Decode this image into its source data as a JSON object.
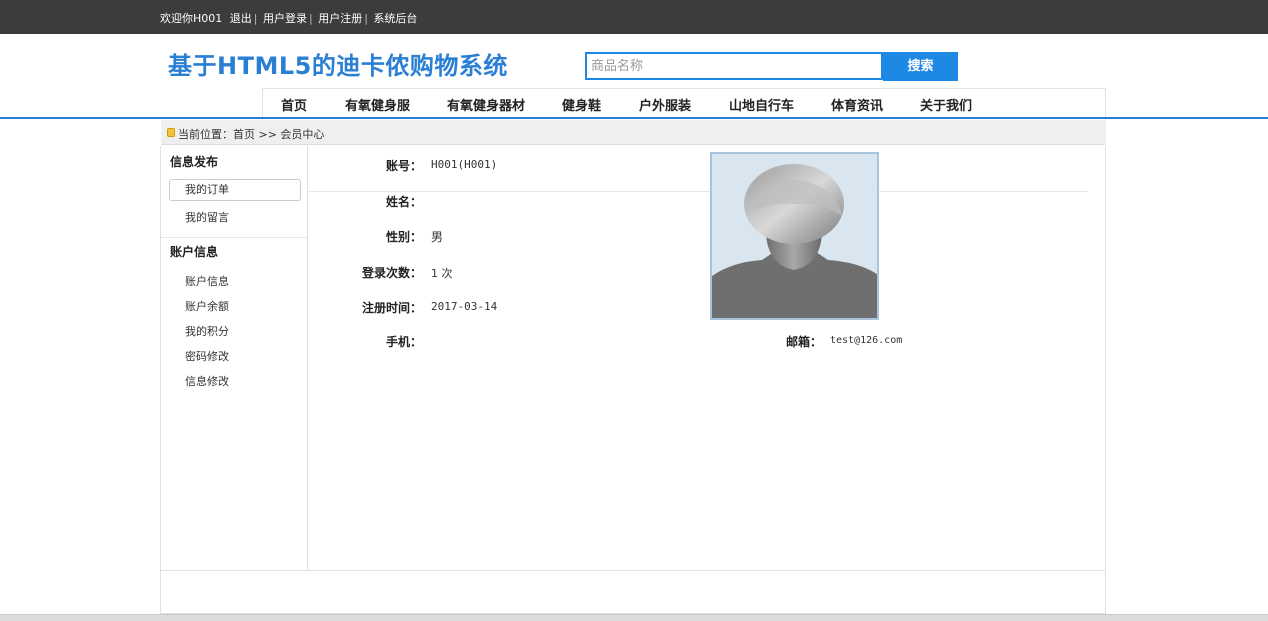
{
  "topbar": {
    "welcome": "欢迎你H001",
    "logout": "退出",
    "login": "用户登录",
    "register": "用户注册",
    "admin": "系统后台",
    "sep": "|"
  },
  "header": {
    "title": "基于HTML5的迪卡侬购物系统",
    "search_placeholder": "商品名称",
    "search_button": "搜索"
  },
  "nav": {
    "items": [
      "首页",
      "有氧健身服",
      "有氧健身器材",
      "健身鞋",
      "户外服装",
      "山地自行车",
      "体育资讯",
      "关于我们"
    ]
  },
  "breadcrumb": {
    "text": "当前位置：首页 >> 会员中心"
  },
  "sidebar": {
    "section1": "信息发布",
    "section1_items": [
      "我的订单",
      "我的留言"
    ],
    "section2": "账户信息",
    "section2_items": [
      "账户信息",
      "账户余额",
      "我的积分",
      "密码修改",
      "信息修改"
    ]
  },
  "profile": {
    "account_label": "账号：",
    "account_value": "H001(H001)",
    "name_label": "姓名：",
    "name_value": "",
    "gender_label": "性别：",
    "gender_value": "男",
    "logins_label": "登录次数：",
    "logins_value": "1 次",
    "regtime_label": "注册时间：",
    "regtime_value": "2017-03-14",
    "phone_label": "手机：",
    "phone_value": "",
    "email_label": "邮箱：",
    "email_value": "test@126.com"
  },
  "colors": {
    "accent": "#2a7fd4",
    "button": "#1e88e5",
    "topbar": "#3c3c3c"
  }
}
